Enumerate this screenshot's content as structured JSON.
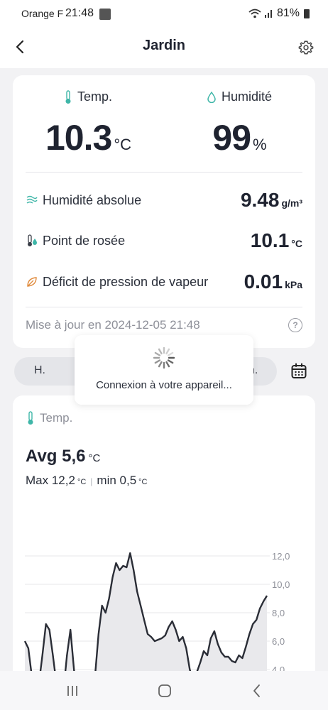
{
  "status_bar": {
    "carrier": "Orange F",
    "time": "21:48",
    "battery": "81%"
  },
  "header": {
    "title": "Jardin"
  },
  "current": {
    "temp_label": "Temp.",
    "temp_value": "10.3",
    "temp_unit": "°C",
    "humidity_label": "Humidité",
    "humidity_value": "99",
    "humidity_unit": "%"
  },
  "details": [
    {
      "label": "Humidité absolue",
      "value": "9.48",
      "unit": "g/m³",
      "icon": "mist-icon"
    },
    {
      "label": "Point de rosée",
      "value": "10.1",
      "unit": "°C",
      "icon": "dew-point-icon"
    },
    {
      "label": "Déficit de pression de vapeur",
      "value": "0.01",
      "unit": "kPa",
      "icon": "leaf-icon"
    }
  ],
  "update_text": "Mise à jour en 2024-12-05 21:48",
  "period": {
    "left": "H.",
    "right": "n."
  },
  "toast": {
    "text": "Connexion à votre appareil..."
  },
  "chart_section": {
    "label": "Temp.",
    "avg_text": "Avg 5,6",
    "avg_unit": "°C",
    "max_text": "Max 12,2",
    "max_unit": "°C",
    "min_text": "min 0,5",
    "min_unit": "°C"
  },
  "colors": {
    "accent_teal": "#3fb6a8",
    "text_dark": "#1f2330",
    "text_muted": "#8e9099",
    "leaf_orange": "#e08a3c"
  },
  "chart_data": {
    "type": "area",
    "x": [
      0,
      1,
      2,
      3,
      4,
      5,
      6,
      7,
      8,
      9,
      10,
      11,
      12,
      13,
      14,
      15,
      16,
      17,
      18,
      19,
      20,
      21,
      22,
      23,
      24,
      25,
      26,
      27,
      28,
      29,
      30,
      31,
      32,
      33,
      34,
      35,
      36,
      37,
      38,
      39,
      40,
      41,
      42,
      43,
      44,
      45,
      46,
      47,
      48,
      49,
      50,
      51,
      52,
      53,
      54,
      55,
      56,
      57,
      58,
      59,
      60,
      61,
      62,
      63,
      64,
      65,
      66,
      67,
      68,
      69
    ],
    "series": [
      {
        "values": [
          6.0,
          5.5,
          3.5,
          2.5,
          3.0,
          5.0,
          7.2,
          6.8,
          5.0,
          3.0,
          2.0,
          2.5,
          5.0,
          6.8,
          4.0,
          2.0,
          1.0,
          1.0,
          1.5,
          2.0,
          3.5,
          6.5,
          8.5,
          8.0,
          9.0,
          10.5,
          11.5,
          11.0,
          11.3,
          11.2,
          12.2,
          11.0,
          9.5,
          8.5,
          7.5,
          6.5,
          6.3,
          6.0,
          6.1,
          6.2,
          6.4,
          7.0,
          7.4,
          6.8,
          6.0,
          6.3,
          5.5,
          4.0,
          3.2,
          3.8,
          4.5,
          5.3,
          5.0,
          6.2,
          6.7,
          5.8,
          5.2,
          4.9,
          4.9,
          4.6,
          4.5,
          5.0,
          4.8,
          5.6,
          6.5,
          7.2,
          7.5,
          8.3,
          8.8,
          9.2
        ]
      }
    ],
    "yticks": [
      "12,0",
      "10,0",
      "8,0",
      "6,0",
      "4,0"
    ],
    "ylim": [
      3.3,
      13.8
    ],
    "grid": true
  }
}
